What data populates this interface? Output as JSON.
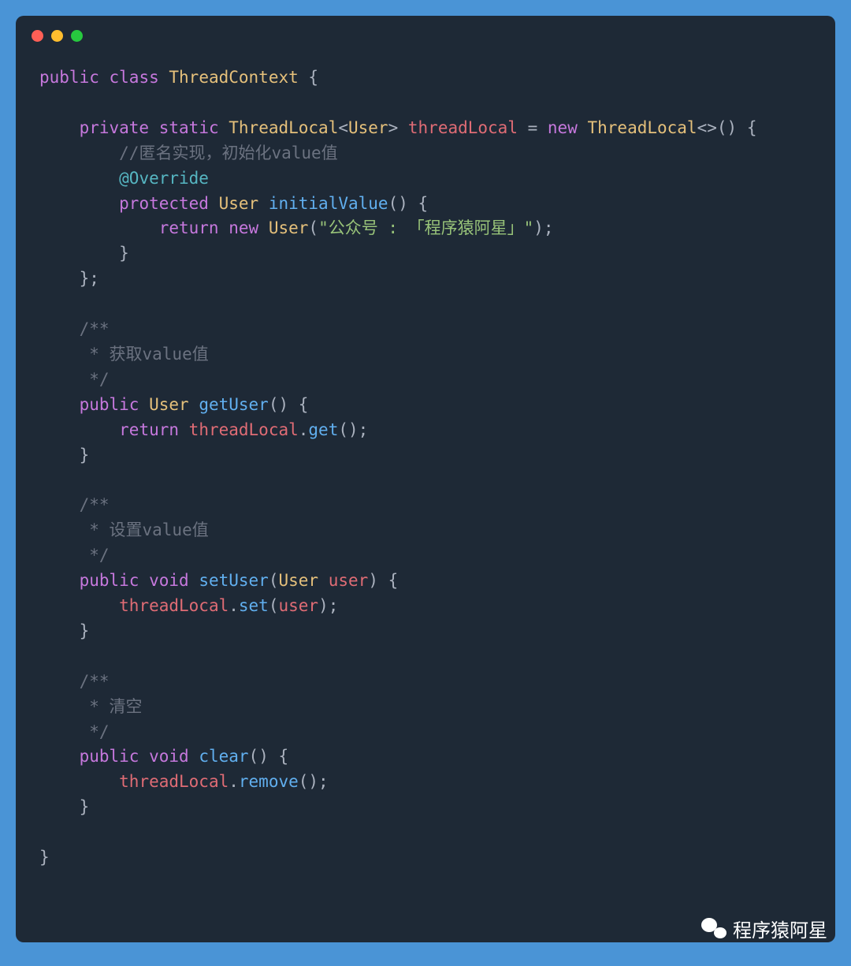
{
  "colors": {
    "background": "#4a94d6",
    "window_bg": "#1e2936",
    "dot_red": "#ff5f56",
    "dot_yellow": "#ffbd2e",
    "dot_green": "#27c93f",
    "modifier": "#c678dd",
    "type": "#e5c07b",
    "method": "#61afef",
    "variable": "#e06c75",
    "string": "#98c379",
    "comment": "#6b7280",
    "annotation": "#56b6c2",
    "punct": "#abb2bf"
  },
  "code": {
    "line1": {
      "public": "public",
      "class": "class",
      "name": "ThreadContext",
      "brace": " {"
    },
    "line3": {
      "indent": "    ",
      "private": "private",
      "static": "static",
      "type": "ThreadLocal",
      "generic_open": "<",
      "generic_type": "User",
      "generic_close": ">",
      "var": "threadLocal",
      "assign": " = ",
      "new": "new",
      "ctor": "ThreadLocal",
      "diamond": "<>",
      "paren": "()",
      "tail": " {"
    },
    "line4": {
      "indent": "        ",
      "comment": "//匿名实现，初始化value值"
    },
    "line5": {
      "indent": "        ",
      "annotation": "@Override"
    },
    "line6": {
      "indent": "        ",
      "protected": "protected",
      "type": "User",
      "method": "initialValue",
      "paren": "()",
      "tail": " {"
    },
    "line7": {
      "indent": "            ",
      "return": "return",
      "new": "new",
      "type": "User",
      "open": "(",
      "string": "\"公众号 : 「程序猿阿星」\"",
      "close": ");"
    },
    "line8": {
      "indent": "        ",
      "brace": "}"
    },
    "line9": {
      "indent": "    ",
      "brace": "};"
    },
    "comment_block1": {
      "l1": "    /**",
      "l2": "     * 获取value值",
      "l3": "     */"
    },
    "getUser": {
      "indent": "    ",
      "public": "public",
      "type": "User",
      "method": "getUser",
      "paren": "()",
      "tail": " {",
      "body_indent": "        ",
      "return": "return",
      "var": "threadLocal",
      "dot": ".",
      "call": "get",
      "close_body": "    }"
    },
    "comment_block2": {
      "l1": "    /**",
      "l2": "     * 设置value值",
      "l3": "     */"
    },
    "setUser": {
      "indent": "    ",
      "public": "public",
      "void": "void",
      "method": "setUser",
      "open": "(",
      "ptype": "User",
      "pname": "user",
      "close": ")",
      "tail": " {",
      "body_indent": "        ",
      "var": "threadLocal",
      "dot": ".",
      "call": "set",
      "arg": "user",
      "close_body": "    }"
    },
    "comment_block3": {
      "l1": "    /**",
      "l2": "     * 清空",
      "l3": "     */"
    },
    "clear": {
      "indent": "    ",
      "public": "public",
      "void": "void",
      "method": "clear",
      "paren": "()",
      "tail": " {",
      "body_indent": "        ",
      "var": "threadLocal",
      "dot": ".",
      "call": "remove",
      "close_body": "    }"
    },
    "close": "}"
  },
  "watermark": {
    "text": "程序猿阿星"
  }
}
